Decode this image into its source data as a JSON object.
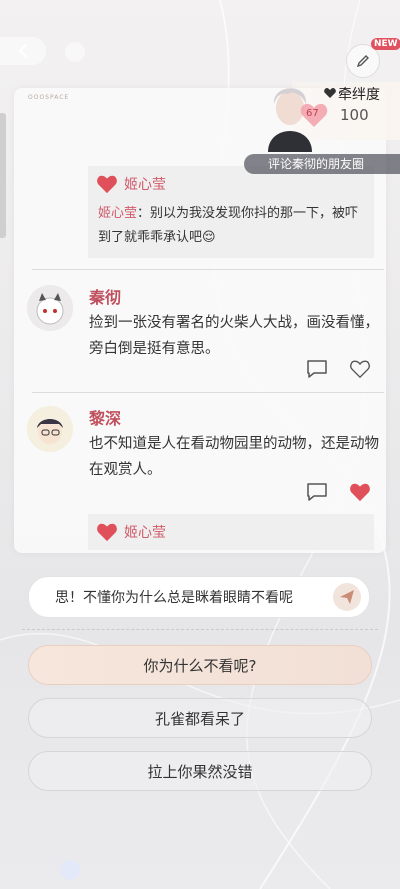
{
  "header": {
    "back_icon": "chevron-left-icon",
    "edit_icon": "pencil-icon",
    "new_badge": "NEW"
  },
  "partner": {
    "relation_label": "牵绊度",
    "relation_value": "100",
    "level": "67",
    "caption": "评论秦彻的朋友圈"
  },
  "card": {
    "logo_text": "OOOSPACE",
    "likes": [
      {
        "name": "姬心莹"
      },
      {
        "name": "姬心莹"
      }
    ],
    "reply": {
      "name": "姬心莹",
      "separator": "：",
      "text": "别以为我没发现你抖的那一下，被吓到了就乖乖承认吧😌"
    },
    "comments": [
      {
        "name": "秦彻",
        "text": "捡到一张没有署名的火柴人大战，画没看懂，旁白倒是挺有意思。",
        "liked": false
      },
      {
        "name": "黎深",
        "text": "也不知道是人在看动物园里的动物，还是动物在观赏人。",
        "liked": true
      }
    ]
  },
  "input": {
    "text": "思！不懂你为什么总是眯着眼睛不看呢",
    "send_icon": "send-icon"
  },
  "options": [
    {
      "label": "你为什么不看呢?"
    },
    {
      "label": "孔雀都看呆了"
    },
    {
      "label": "拉上你果然没错"
    }
  ],
  "colors": {
    "accent": "#d05a6a",
    "heart": "#e0505a"
  }
}
